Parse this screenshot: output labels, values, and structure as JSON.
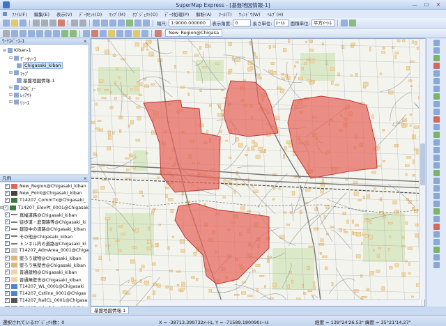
{
  "window": {
    "title": "SuperMap Express - [基盤地図情報-1]"
  },
  "menu": [
    "ﾌｧｲﾙ(F)",
    "編集(E)",
    "表示(V)",
    "ﾃﾞｰﾀｾｯﾄ(D)",
    "ﾏｯﾌﾟ(M)",
    "ｵﾌﾞｼﾞｪｸﾄ(O)",
    "ﾃﾞｰﾀ処理(P)",
    "解析(A)",
    "ﾂｰﾙ(T)",
    "ｳｨﾝﾄﾞｳ(W)",
    "ﾍﾙﾌﾟ(H)"
  ],
  "toolbar": {
    "scale_label": "縮尺:",
    "scale_value": "1:9000.000000",
    "angle_label": "表示角度:",
    "angle_value": "0",
    "length_label": "長さ単位:",
    "length_value": "ﾒｰﾄﾙ",
    "area_label": "面積単位:",
    "area_value": "平方ﾒｰﾄﾙ",
    "layer_tab": "New_Region@Chigasa"
  },
  "workspace": {
    "header": "ﾜｰｸｽﾍﾟｰｽ-1",
    "items": [
      {
        "label": "Kiban-1",
        "level": 0
      },
      {
        "label": "ﾃﾞｰﾀｿｰｽ",
        "level": 1
      },
      {
        "label": "Chigasaki_kiban",
        "level": 2
      },
      {
        "label": "ﾏｯﾌﾟ",
        "level": 1
      },
      {
        "label": "基盤地図情報-1",
        "level": 2
      },
      {
        "label": "3Dﾋﾞｭｰ",
        "level": 1
      },
      {
        "label": "ﾚｲｱｳﾄ",
        "level": 1
      },
      {
        "label": "ﾘｿｰｽ",
        "level": 1
      }
    ]
  },
  "legend": {
    "header": "凡例",
    "items": [
      {
        "label": "New_Region@Chigasaki_kiban",
        "color": "#e5655c"
      },
      {
        "label": "New_Point@Chigasaki_kiban",
        "color": "#444444"
      },
      {
        "label": "T14207_CommTx@Chigasaki_",
        "color": "#3a7a3a"
      },
      {
        "label": "T14207_ElevPt_0001@Chigasaki",
        "color": "#3a7a3a"
      },
      {
        "label": "真幅道路@Chigasaki_kiban",
        "color": "#777777"
      },
      {
        "label": "徒歩道・庭園路等@Chigasaki_ki",
        "color": "#777777"
      },
      {
        "label": "建設中の道路@Chigasaki_kiban",
        "color": "#777777"
      },
      {
        "label": "その他@Chigasaki_kiban",
        "color": "#777777"
      },
      {
        "label": "トンネル内の道路@Chigasaki_ki",
        "color": "#777777"
      },
      {
        "label": "T14207_AdmArea_0001@Chiga",
        "color": "#cccccc"
      },
      {
        "label": "堅ろう建物@Chigasaki_kiban",
        "color": "#e2b67a"
      },
      {
        "label": "堅ろう無壁舎@Chigasaki_kiban",
        "color": "#e2b67a"
      },
      {
        "label": "普通建物@Chigasaki_kiban",
        "color": "#f1d3a0"
      },
      {
        "label": "普通無壁舎@Chigasaki_kiban",
        "color": "#f1d3a0"
      },
      {
        "label": "T14207_WL_0001@Chigasaki",
        "color": "#4f86d4"
      },
      {
        "label": "T14207_Cstline_0001@Chigas",
        "color": "#4f86d4"
      },
      {
        "label": "T14207_RailCL_0001@Chigasa",
        "color": "#555555"
      },
      {
        "label": "T14207_AdmBdry_0001@Chig",
        "color": "#8a8a8a"
      }
    ]
  },
  "map": {
    "tab": "基盤地図情報-1",
    "region_color": "#e5655c"
  },
  "status": {
    "selected": "選択されているｵﾌﾞｼﾞｪｸﾄ数：0",
    "coords": "X = -38713.399732ﾒｰﾄﾙ, Y = -71589.180090ﾒｰﾄﾙ",
    "lonlat": "経度 = 139°24'26.53\"  緯度 = 35°21'14.27\""
  }
}
